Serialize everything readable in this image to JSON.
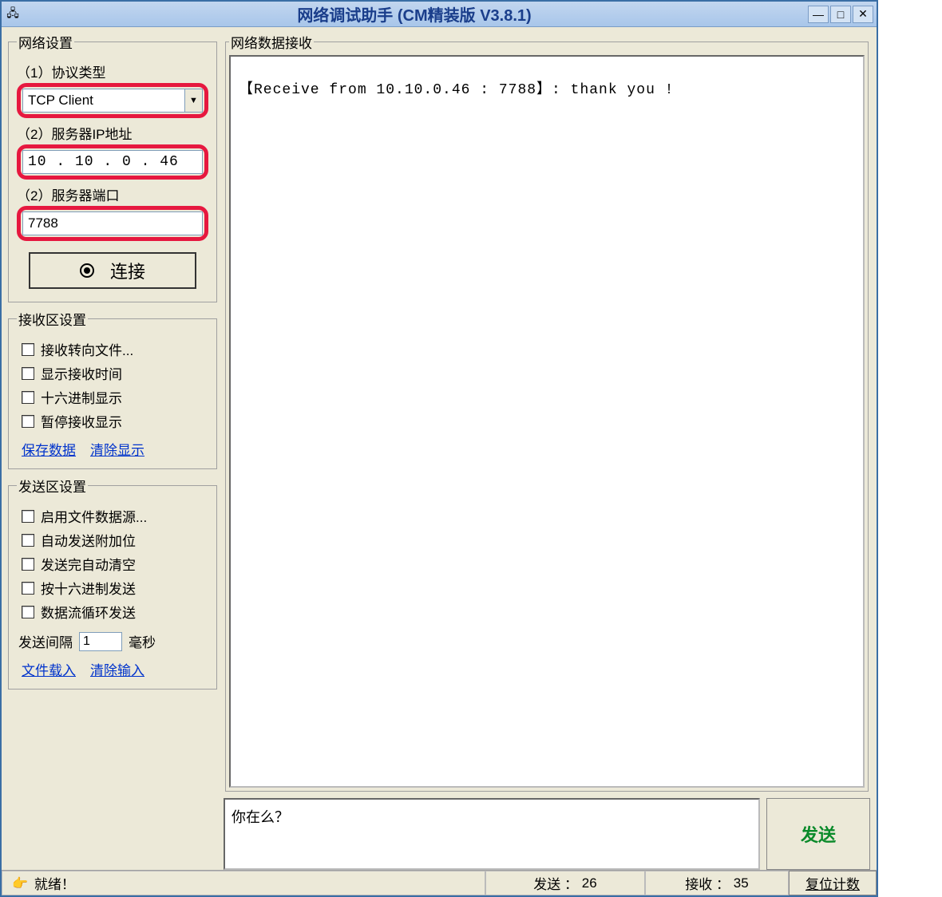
{
  "titlebar": {
    "title": "网络调试助手  (CM精装版  V3.8.1)"
  },
  "network": {
    "legend": "网络设置",
    "protocol_label": "（1）协议类型",
    "protocol_value": "TCP Client",
    "ip_label": "（2）服务器IP地址",
    "ip_value": "10 . 10 .  0  . 46",
    "port_label": "（2）服务器端口",
    "port_value": "7788",
    "connect_label": "连接"
  },
  "recv_opts": {
    "legend": "接收区设置",
    "items": [
      "接收转向文件...",
      "显示接收时间",
      "十六进制显示",
      "暂停接收显示"
    ],
    "save_link": "保存数据",
    "clear_link": "清除显示"
  },
  "send_opts": {
    "legend": "发送区设置",
    "items": [
      "启用文件数据源...",
      "自动发送附加位",
      "发送完自动清空",
      "按十六进制发送",
      "数据流循环发送"
    ],
    "interval_label": "发送间隔",
    "interval_value": "1",
    "interval_unit": "毫秒",
    "load_link": "文件载入",
    "clear_link": "清除输入"
  },
  "recv_area": {
    "legend": "网络数据接收",
    "text": "【Receive from 10.10.0.46 : 7788】: thank you !"
  },
  "send_area": {
    "text": "你在么？",
    "button": "发送"
  },
  "status": {
    "ready": "就绪！",
    "send_label": "发送 ：",
    "send_count": "26",
    "recv_label": "接收 ：",
    "recv_count": "35",
    "reset": "复位计数"
  }
}
